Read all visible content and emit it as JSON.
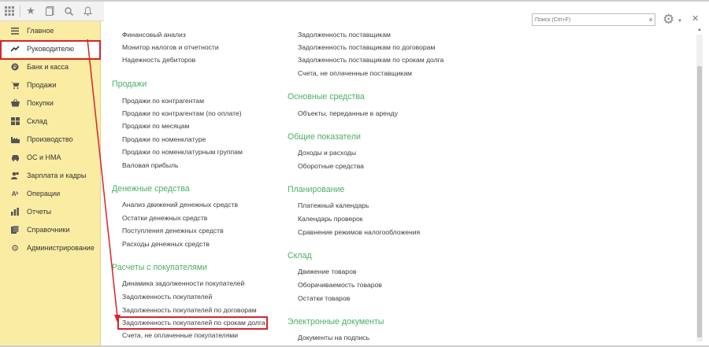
{
  "toolbar": {
    "icons": [
      "grid-icon",
      "star-icon",
      "history-icon",
      "search-icon",
      "bell-icon"
    ]
  },
  "sidebar": {
    "items": [
      {
        "label": "Главное",
        "icon": "menu-lines-icon"
      },
      {
        "label": "Руководителю",
        "icon": "trend-icon"
      },
      {
        "label": "Банк и касса",
        "icon": "coin-icon"
      },
      {
        "label": "Продажи",
        "icon": "cart-icon"
      },
      {
        "label": "Покупки",
        "icon": "basket-icon"
      },
      {
        "label": "Склад",
        "icon": "warehouse-icon"
      },
      {
        "label": "Производство",
        "icon": "factory-icon"
      },
      {
        "label": "ОС и НМА",
        "icon": "car-icon"
      },
      {
        "label": "Зарплата и кадры",
        "icon": "people-icon"
      },
      {
        "label": "Операции",
        "icon": "operations-icon"
      },
      {
        "label": "Отчеты",
        "icon": "chart-icon"
      },
      {
        "label": "Справочники",
        "icon": "books-icon"
      },
      {
        "label": "Администрирование",
        "icon": "gear-icon"
      }
    ]
  },
  "search": {
    "placeholder": "Поиск (Ctrl+F)"
  },
  "left_column": {
    "top_links": [
      "Финансовый анализ",
      "Монитор налогов и отчетности",
      "Надежность дебиторов"
    ],
    "sales": {
      "title": "Продажи",
      "links": [
        "Продажи по контрагентам",
        "Продажи по контрагентам (по оплате)",
        "Продажи по месяцам",
        "Продажи по номенклатуре",
        "Продажи по номенклатурным группам",
        "Валовая прибыль"
      ]
    },
    "cash": {
      "title": "Денежные средства",
      "links": [
        "Анализ движений денежных средств",
        "Остатки денежных средств",
        "Поступления денежных средств",
        "Расходы денежных средств"
      ]
    },
    "customers": {
      "title": "Расчеты с покупателями",
      "links": [
        "Динамика задолженности покупателей",
        "Задолженность покупателей",
        "Задолженность покупателей по договорам",
        "Задолженность покупателей по срокам долга",
        "Счета, не оплаченные покупателями"
      ]
    }
  },
  "right_column": {
    "top_links": [
      "Задолженность поставщикам",
      "Задолженность поставщикам по договорам",
      "Задолженность поставщикам по срокам долга",
      "Счета, не оплаченные поставщикам"
    ],
    "assets": {
      "title": "Основные средства",
      "links": [
        "Объекты, переданные в аренду"
      ]
    },
    "general": {
      "title": "Общие показатели",
      "links": [
        "Доходы и расходы",
        "Оборотные средства"
      ]
    },
    "planning": {
      "title": "Планирование",
      "links": [
        "Платежный календарь",
        "Календарь проверок",
        "Сравнение режимов налогообложения"
      ]
    },
    "warehouse": {
      "title": "Склад",
      "links": [
        "Движение товаров",
        "Оборачиваемость товаров",
        "Остатки товаров"
      ]
    },
    "edocs": {
      "title": "Электронные документы",
      "links": [
        "Документы на подпись"
      ]
    }
  },
  "colors": {
    "accent_green": "#4caf66",
    "sidebar_bg": "#fbeca3",
    "highlight_red": "#d9232d"
  }
}
